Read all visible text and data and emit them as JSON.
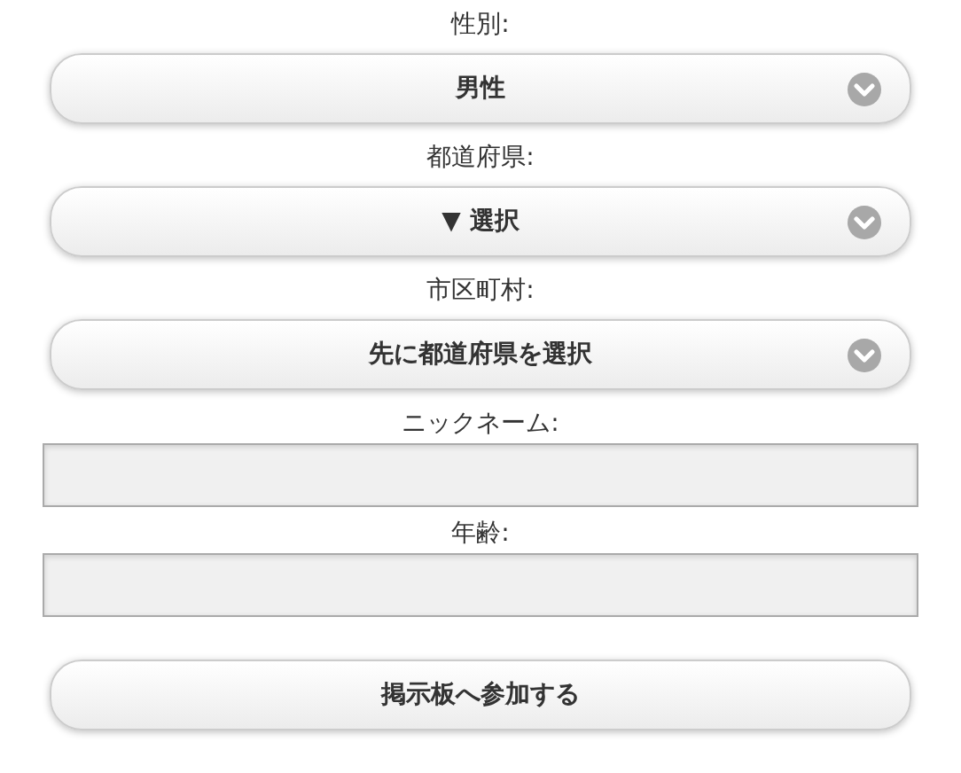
{
  "fields": [
    {
      "kind": "select",
      "label": "性別:",
      "value": "男性"
    },
    {
      "kind": "select",
      "label": "都道府県:",
      "value": "▼ 選択"
    },
    {
      "kind": "select",
      "label": "市区町村:",
      "value": "先に都道府県を選択"
    },
    {
      "kind": "text",
      "label": "ニックネーム:"
    },
    {
      "kind": "text",
      "label": "年齢:"
    }
  ],
  "submit": {
    "label": "掲示板へ参加する"
  }
}
